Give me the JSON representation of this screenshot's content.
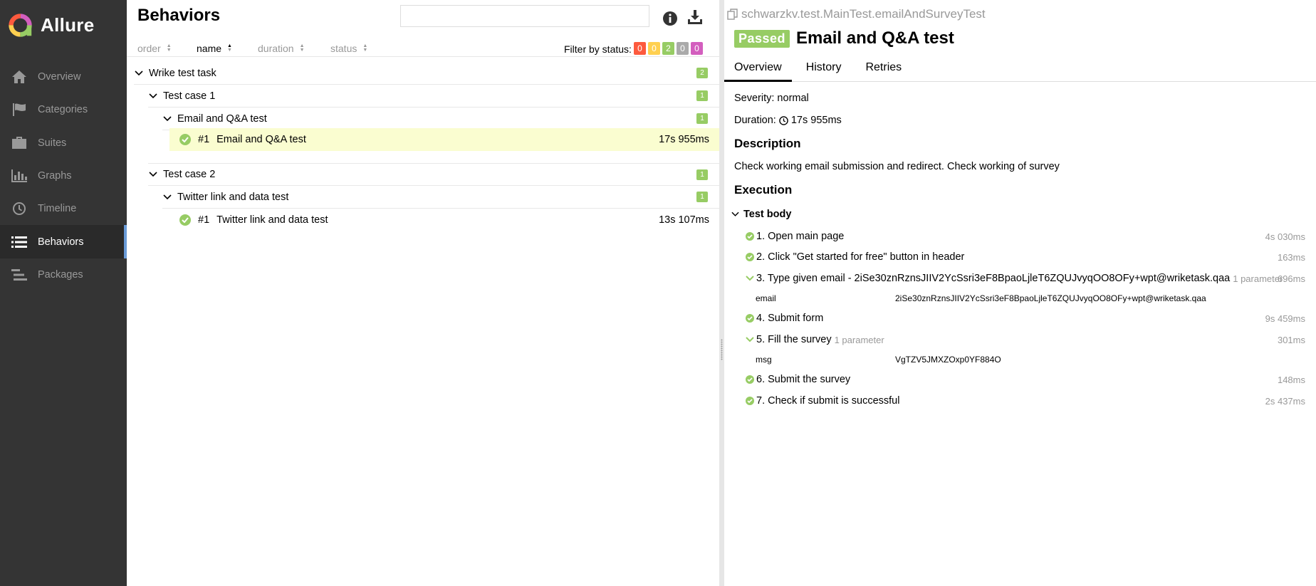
{
  "app": {
    "name": "Allure"
  },
  "sidebar": {
    "items": [
      {
        "label": "Overview",
        "icon": "home-icon"
      },
      {
        "label": "Categories",
        "icon": "flag-icon"
      },
      {
        "label": "Suites",
        "icon": "briefcase-icon"
      },
      {
        "label": "Graphs",
        "icon": "bar-chart-icon"
      },
      {
        "label": "Timeline",
        "icon": "clock-icon"
      },
      {
        "label": "Behaviors",
        "icon": "list-icon",
        "active": true
      },
      {
        "label": "Packages",
        "icon": "packages-icon"
      }
    ]
  },
  "tree_panel": {
    "title": "Behaviors",
    "search": {
      "value": "",
      "placeholder": ""
    },
    "sort": {
      "order": "order",
      "name": "name",
      "duration": "duration",
      "status": "status"
    },
    "filter": {
      "label": "Filter by status:",
      "counts": [
        "0",
        "0",
        "2",
        "0",
        "0"
      ],
      "colors": [
        "#fd5a3e",
        "#ffd050",
        "#97cc64",
        "#aaaaaa",
        "#d35ebe"
      ]
    },
    "groups": {
      "epic": {
        "label": "Wrike test task",
        "count": "2"
      },
      "case1": {
        "label": "Test case 1",
        "count": "1"
      },
      "story1": {
        "label": "Email and Q&A test",
        "count": "1"
      },
      "leaf1": {
        "num": "#1",
        "label": "Email and Q&A test",
        "duration": "17s 955ms"
      },
      "case2": {
        "label": "Test case 2",
        "count": "1"
      },
      "story2": {
        "label": "Twitter link and data test",
        "count": "1"
      },
      "leaf2": {
        "num": "#1",
        "label": "Twitter link and data test",
        "duration": "13s 107ms"
      }
    }
  },
  "details": {
    "full_name": "schwarzkv.test.MainTest.emailAndSurveyTest",
    "status": "Passed",
    "title": "Email and Q&A test",
    "tabs": [
      "Overview",
      "History",
      "Retries"
    ],
    "severity": "Severity: normal",
    "duration_label": "Duration:",
    "duration_value": "17s 955ms",
    "description_title": "Description",
    "description": "Check working email submission and redirect. Check working of survey",
    "execution_title": "Execution",
    "test_body": "Test body",
    "steps": [
      {
        "label": "1. Open main page",
        "duration": "4s 030ms"
      },
      {
        "label": "2. Click \"Get started for free\" button in header",
        "duration": "163ms"
      },
      {
        "label": "3. Type given email - 2iSe30znRznsJIIV2YcSsri3eF8BpaoLjleT6ZQUJvyqOO8OFy+wpt@wriketask.qaa",
        "param_hint": "1 parameter",
        "duration": "696ms"
      },
      {
        "label": "4. Submit form",
        "duration": "9s 459ms"
      },
      {
        "label": "5. Fill the survey",
        "param_hint": "1 parameter",
        "duration": "301ms"
      },
      {
        "label": "6. Submit the survey",
        "duration": "148ms"
      },
      {
        "label": "7. Check if submit is successful",
        "duration": "2s 437ms"
      }
    ],
    "params": [
      {
        "name": "email",
        "value": "2iSe30znRznsJIIV2YcSsri3eF8BpaoLjleT6ZQUJvyqOO8OFy+wpt@wriketask.qaa"
      },
      {
        "name": "msg",
        "value": "VgTZV5JMXZOxp0YF884O"
      }
    ]
  }
}
